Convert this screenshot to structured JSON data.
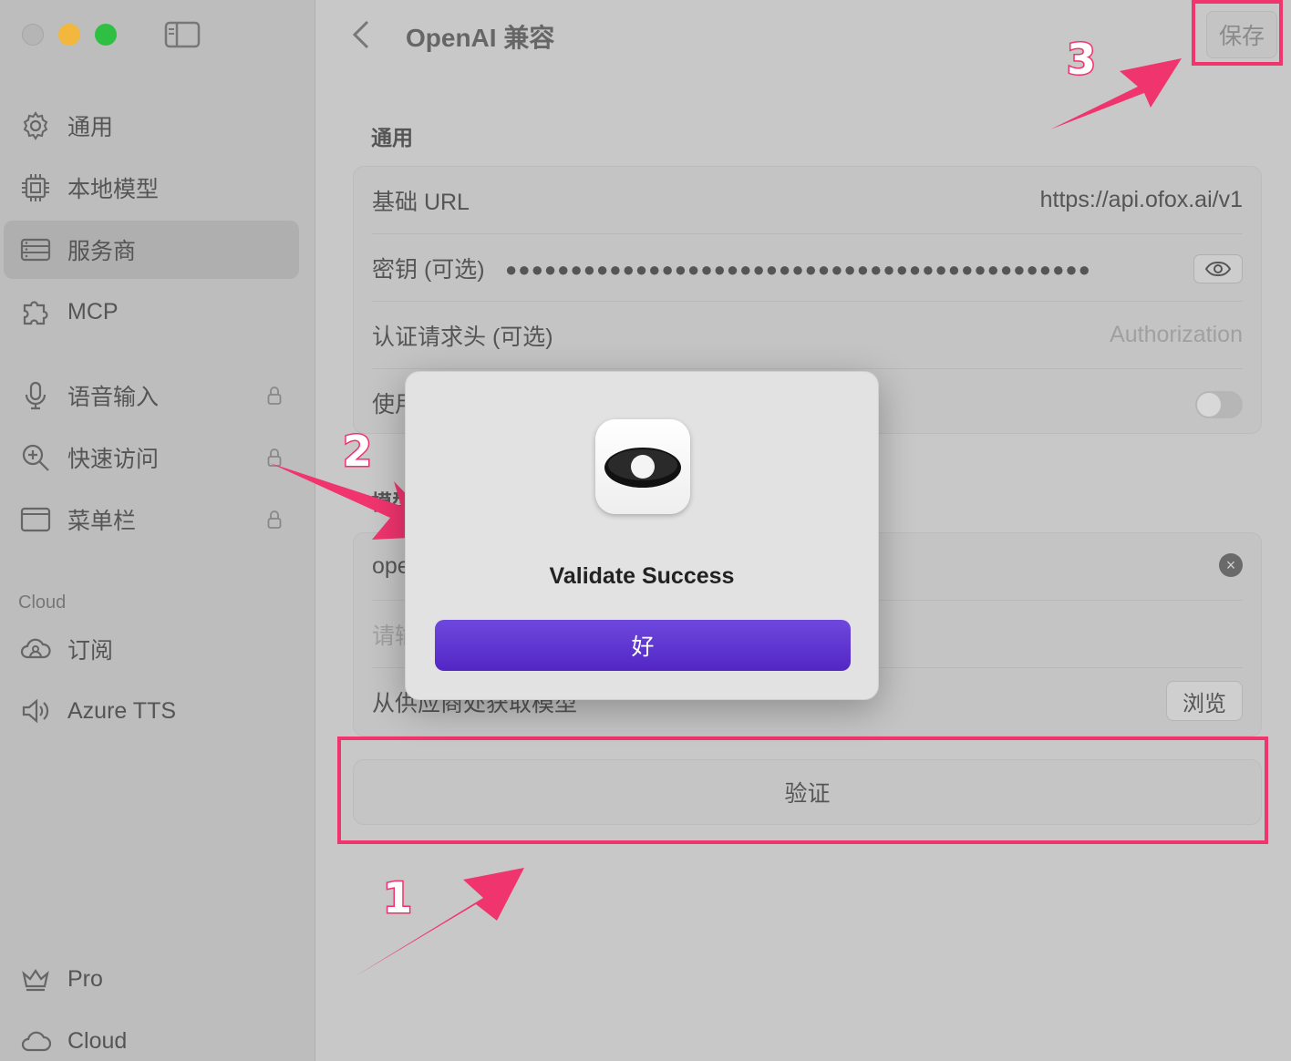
{
  "sidebar": {
    "items": [
      {
        "label": "通用",
        "icon": "gear-icon"
      },
      {
        "label": "本地模型",
        "icon": "chip-icon"
      },
      {
        "label": "服务商",
        "icon": "server-icon",
        "active": true
      },
      {
        "label": "MCP",
        "icon": "puzzle-icon"
      },
      {
        "label": "语音输入",
        "icon": "microphone-icon",
        "locked": true
      },
      {
        "label": "快速访问",
        "icon": "zoom-search-icon",
        "locked": true
      },
      {
        "label": "菜单栏",
        "icon": "window-icon",
        "locked": true
      },
      {
        "label": "订阅",
        "icon": "cloud-person-icon"
      },
      {
        "label": "Azure TTS",
        "icon": "speaker-icon"
      },
      {
        "label": "Pro",
        "icon": "crown-icon"
      },
      {
        "label": "Cloud",
        "icon": "cloud-icon"
      }
    ],
    "section_cloud": "Cloud"
  },
  "header": {
    "title": "OpenAI 兼容",
    "save_label": "保存"
  },
  "general": {
    "title": "通用",
    "base_url_label": "基础 URL",
    "base_url_value": "https://api.ofox.ai/v1",
    "key_label": "密钥 (可选)",
    "key_mask": "●●●●●●●●●●●●●●●●●●●●●●●●●●●●●●●●●●●●●●●●●●●●●",
    "auth_label": "认证请求头 (可选)",
    "auth_placeholder": "Authorization",
    "use_label_partial": "使用"
  },
  "models": {
    "section_partial": "模型",
    "model_partial": "ope",
    "input_partial": "请输",
    "fetch_label": "从供应商处获取模型",
    "browse_label": "浏览"
  },
  "verify_label": "验证",
  "dialog": {
    "title": "Validate Success",
    "ok_label": "好"
  },
  "annotations": {
    "n1": "1",
    "n2": "2",
    "n3": "3",
    "color": "#f0346e"
  }
}
